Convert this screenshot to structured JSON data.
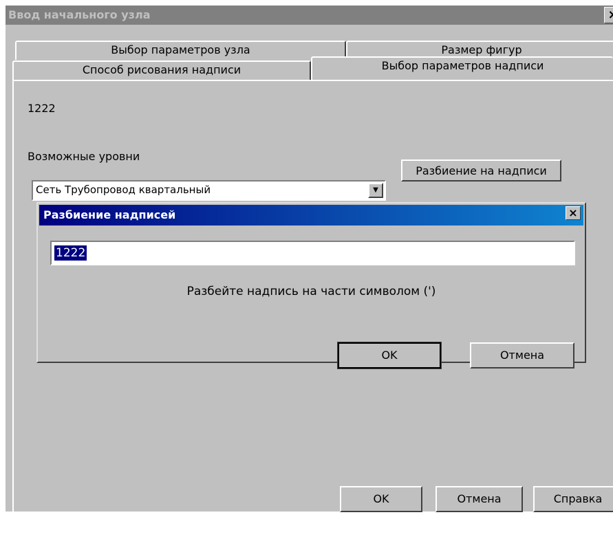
{
  "window": {
    "title": "Ввод начального узла",
    "close_glyph": "×",
    "tabs_back": [
      "Выбор параметров узла",
      "Размер фигур"
    ],
    "tabs_front": [
      "Способ рисования надписи",
      "Выбор параметров надписи"
    ],
    "active_tab": "Выбор параметров надписи"
  },
  "panel": {
    "node_text": "1222",
    "levels_label": "Возможные уровни",
    "levels_select_value": "Сеть Трубопровод квартальный",
    "split_button_label": "Разбиение на надписи"
  },
  "dialog": {
    "title": "Разбиение надписей",
    "close_glyph": "×",
    "input_value": "1222",
    "hint": "Разбейте надпись на части символом (')",
    "ok_label": "OK",
    "cancel_label": "Отмена"
  },
  "footer": {
    "ok_label": "OK",
    "cancel_label": "Отмена",
    "help_label": "Справка"
  },
  "colors": {
    "dialog_title_bg": "#000080",
    "window_bg": "#c0c0c0",
    "inactive_title_bg": "#808080"
  }
}
